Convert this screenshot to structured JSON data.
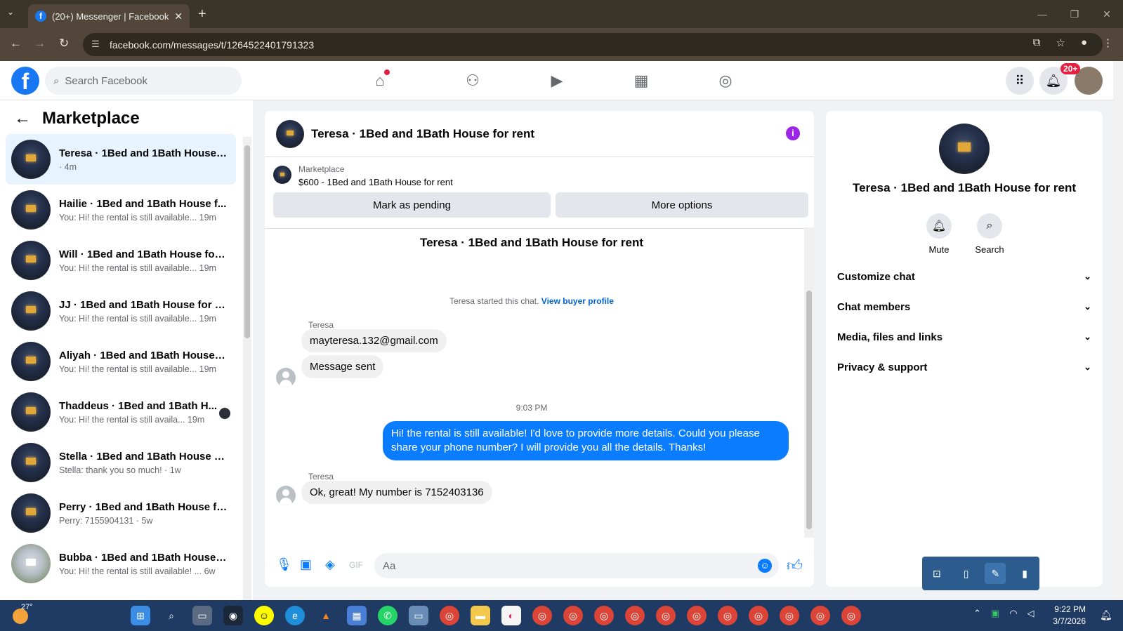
{
  "browser": {
    "tab_title": "(20+) Messenger | Facebook",
    "new_tab": "+",
    "url": "facebook.com/messages/t/1264522401791323"
  },
  "fb": {
    "search_placeholder": "Search Facebook",
    "notification_badge": "20+"
  },
  "sidebar": {
    "title": "Marketplace",
    "conversations": [
      {
        "name": "Teresa · 1Bed and 1Bath House f...",
        "snippet": "· 4m",
        "active": true
      },
      {
        "name": "Hailie · 1Bed and 1Bath House f...",
        "snippet": "You: Hi! the rental is still available... 19m"
      },
      {
        "name": "Will · 1Bed and 1Bath House for ...",
        "snippet": "You: Hi! the rental is still available... 19m"
      },
      {
        "name": "JJ · 1Bed and 1Bath House for rent",
        "snippet": "You: Hi! the rental is still available... 19m"
      },
      {
        "name": "Aliyah · 1Bed and 1Bath House f...",
        "snippet": "You: Hi! the rental is still available... 19m"
      },
      {
        "name": "Thaddeus · 1Bed and 1Bath H...",
        "snippet": "You: Hi! the rental is still availa... 19m"
      },
      {
        "name": "Stella · 1Bed and 1Bath House fo...",
        "snippet": "Stella: thank you so much! · 1w"
      },
      {
        "name": "Perry · 1Bed and 1Bath House fo...",
        "snippet": "Perry: 7155904131 · 5w"
      },
      {
        "name": "Bubba · 1Bed and 1Bath House f...",
        "snippet": "You: Hi! the rental is still available! ... 6w"
      }
    ]
  },
  "chat": {
    "header_title": "Teresa · 1Bed and 1Bath House for rent",
    "marketplace_label": "Marketplace",
    "listing": "$600 - 1Bed and 1Bath House for rent",
    "mark_pending": "Mark as pending",
    "more_options": "More options",
    "thread_title": "Teresa · 1Bed and 1Bath House for rent",
    "system_text": "Teresa started this chat.",
    "view_buyer_profile": "View buyer profile",
    "sender_1": "Teresa",
    "msg_1": "mayteresa.132@gmail.com",
    "msg_2": "Message sent",
    "timestamp": "9:03 PM",
    "my_msg": "Hi! the rental is still available! I'd love to provide more details. Could you please share your phone number? I will provide you all the details. Thanks!",
    "sender_2": "Teresa",
    "msg_3": "Ok, great! My number is 7152403136",
    "composer_placeholder": "Aa"
  },
  "details": {
    "name": "Teresa · 1Bed and 1Bath House for rent",
    "mute": "Mute",
    "search": "Search",
    "sections": [
      "Customize chat",
      "Chat members",
      "Media, files and links",
      "Privacy & support"
    ]
  },
  "taskbar": {
    "temperature": "27°",
    "clock_time": "9:22 PM",
    "clock_date": "3/7/2026"
  },
  "colors": {
    "fb_blue": "#1877f2",
    "messenger_blue": "#0a7cff",
    "active_row": "#e7f3ff",
    "notification_red": "#e41e3f"
  }
}
